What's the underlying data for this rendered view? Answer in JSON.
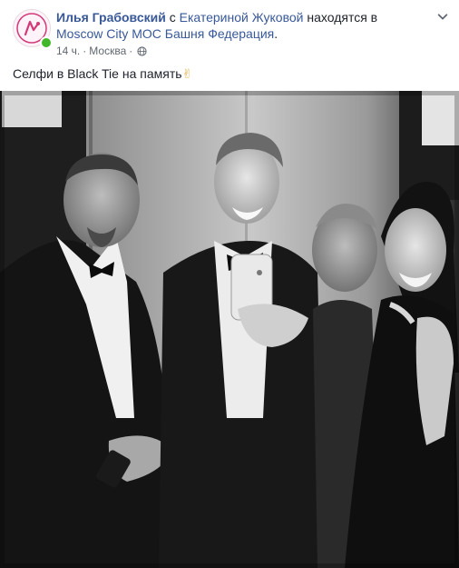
{
  "post": {
    "author": "Илья Грабовский",
    "with_prefix": "с",
    "tagged_person": "Екатериной Жуковой",
    "location_prefix": "находятся в",
    "location": "Moscow City MOC Башня Федерация",
    "location_suffix": ".",
    "time": "14 ч.",
    "separator": "·",
    "city": "Москва",
    "privacy_icon": "globe-icon",
    "caption_text": "Селфи в Black Tie на память",
    "caption_emoji": "✌",
    "menu_icon": "chevron-down-icon",
    "online_status_color": "#42b72a",
    "link_color": "#385898"
  },
  "photo": {
    "description_icon": "black-and-white-group-selfie"
  }
}
